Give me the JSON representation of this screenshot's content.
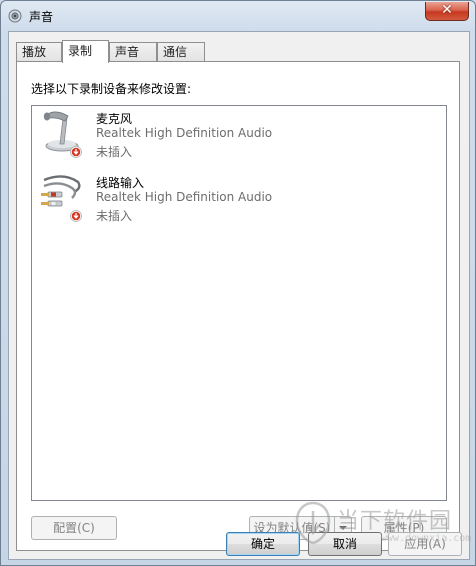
{
  "window": {
    "title": "声音",
    "close_label": "✕"
  },
  "tabs": [
    {
      "label": "播放",
      "active": false
    },
    {
      "label": "录制",
      "active": true
    },
    {
      "label": "声音",
      "active": false
    },
    {
      "label": "通信",
      "active": false
    }
  ],
  "recording": {
    "instruction": "选择以下录制设备来修改设置:",
    "devices": [
      {
        "name": "麦克风",
        "driver": "Realtek High Definition Audio",
        "status": "未插入",
        "icon": "microphone-icon"
      },
      {
        "name": "线路输入",
        "driver": "Realtek High Definition Audio",
        "status": "未插入",
        "icon": "line-in-cable-icon"
      }
    ]
  },
  "buttons": {
    "configure": "配置(C)",
    "set_default": "设为默认值(S)",
    "properties": "属性(P)",
    "ok": "确定",
    "cancel": "取消",
    "apply": "应用(A)"
  },
  "watermark": {
    "text": "当下软件园",
    "url": "www.downxia.com"
  }
}
